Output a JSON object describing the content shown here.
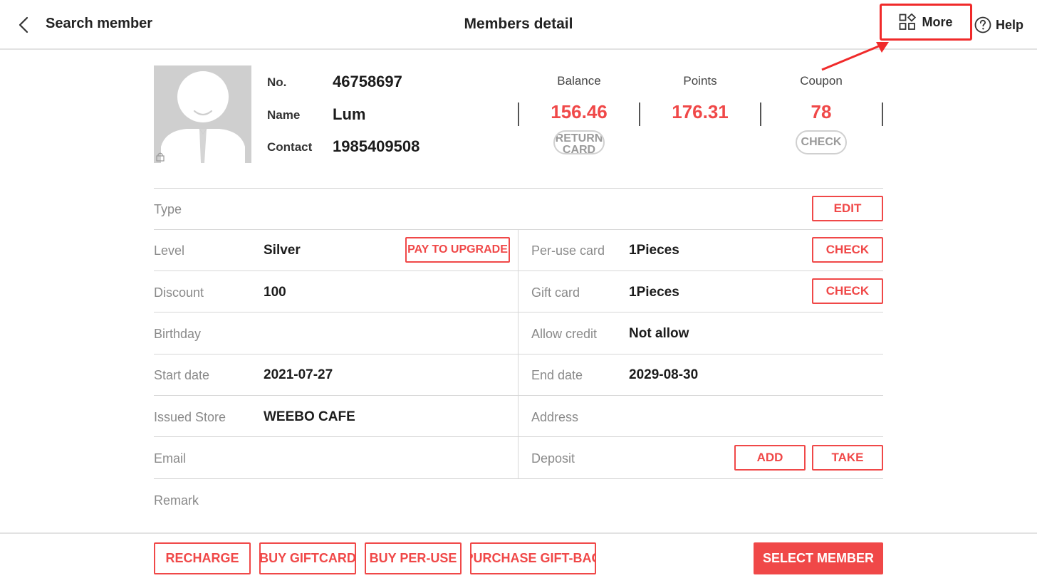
{
  "header": {
    "back_label": "Search member",
    "title": "Members detail",
    "more_label": "More",
    "help_label": "Help"
  },
  "member": {
    "no_label": "No.",
    "no_value": "46758697",
    "name_label": "Name",
    "name_value": "Lum",
    "contact_label": "Contact",
    "contact_value": "1985409508"
  },
  "stats": {
    "balance_label": "Balance",
    "balance_value": "156.46",
    "balance_action": "RETURN CARD",
    "points_label": "Points",
    "points_value": "176.31",
    "coupon_label": "Coupon",
    "coupon_value": "78",
    "coupon_action": "CHECK"
  },
  "details": {
    "type_label": "Type",
    "type_edit": "EDIT",
    "level_label": "Level",
    "level_value": "Silver",
    "level_action": "PAY TO UPGRADE",
    "peruse_label": "Per-use card",
    "peruse_value": "1Pieces",
    "peruse_action": "CHECK",
    "discount_label": "Discount",
    "discount_value": "100",
    "giftcard_label": "Gift card",
    "giftcard_value": "1Pieces",
    "giftcard_action": "CHECK",
    "birthday_label": "Birthday",
    "credit_label": "Allow credit",
    "credit_value": "Not allow",
    "start_label": "Start date",
    "start_value": "2021-07-27",
    "end_label": "End date",
    "end_value": "2029-08-30",
    "store_label": "Issued Store",
    "store_value": "WEEBO CAFE",
    "address_label": "Address",
    "email_label": "Email",
    "deposit_label": "Deposit",
    "deposit_add": "ADD",
    "deposit_take": "TAKE",
    "remark_label": "Remark"
  },
  "footer": {
    "recharge": "RECHARGE",
    "buy_giftcard": "BUY GIFTCARD",
    "buy_peruse": "BUY PER-USE",
    "purchase_giftbag": "PURCHASE GIFT-BAG",
    "select_member": "SELECT MEMBER"
  },
  "colors": {
    "accent": "#f04848",
    "highlight_box": "#f02a2a",
    "divider": "#d6d6d6"
  },
  "icons": {
    "back": "chevron-left-icon",
    "more": "apps-grid-icon",
    "help": "question-circle-icon",
    "avatar": "default-avatar-icon",
    "lock": "lock-icon"
  }
}
